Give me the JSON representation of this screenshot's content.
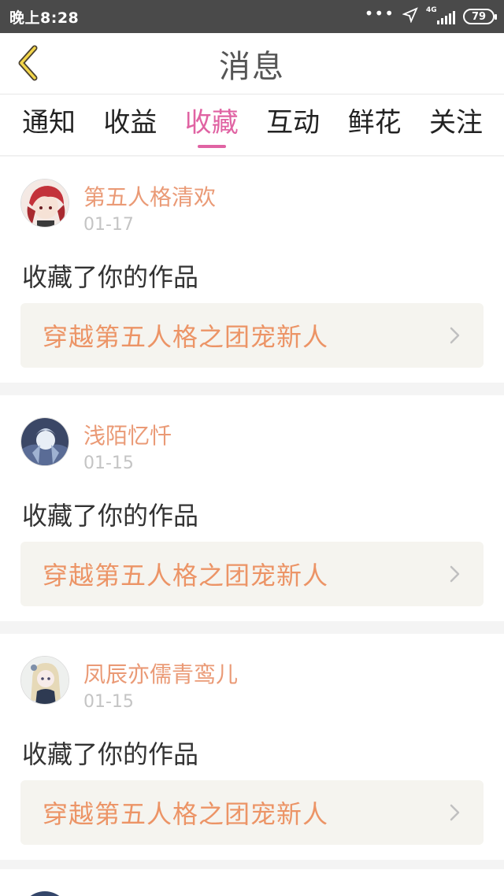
{
  "status_bar": {
    "time": "晚上8:28",
    "network": "4G",
    "battery": "79",
    "icons": [
      "more-dots-icon",
      "location-arrow-icon",
      "signal-icon",
      "battery-icon"
    ]
  },
  "nav": {
    "title": "消息",
    "back_icon": "chevron-left-icon"
  },
  "tabs": [
    {
      "label": "通知",
      "active": false
    },
    {
      "label": "收益",
      "active": false
    },
    {
      "label": "收藏",
      "active": true
    },
    {
      "label": "互动",
      "active": false
    },
    {
      "label": "鲜花",
      "active": false
    },
    {
      "label": "关注",
      "active": false
    }
  ],
  "colors": {
    "accent": "#e063a3",
    "username": "#ea9a76",
    "work_title": "#ec9466",
    "date": "#c4c4c4",
    "link_bg": "#f5f4ef"
  },
  "items": [
    {
      "username": "第五人格清欢",
      "date": "01-17",
      "action": "收藏了你的作品",
      "work_title": "穿越第五人格之团宠新人"
    },
    {
      "username": "浅陌忆忏",
      "date": "01-15",
      "action": "收藏了你的作品",
      "work_title": "穿越第五人格之团宠新人"
    },
    {
      "username": "凤辰亦儒青鸾儿",
      "date": "01-15",
      "action": "收藏了你的作品",
      "work_title": "穿越第五人格之团宠新人"
    }
  ]
}
